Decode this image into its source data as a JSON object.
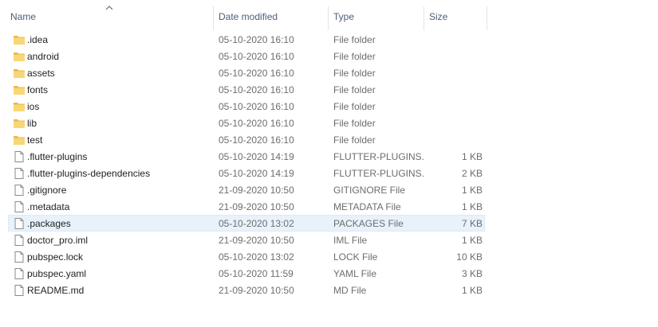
{
  "columns": {
    "name": "Name",
    "date_modified": "Date modified",
    "type": "Type",
    "size": "Size"
  },
  "sort_indicator": "ascending-arrow-icon",
  "colors": {
    "folder": "#f8d775",
    "folder_dark": "#e7b94f",
    "selection_bg": "#e8f2fb",
    "selection_border": "#d9ebf9",
    "header_text": "#4c607a"
  },
  "files": [
    {
      "name": ".idea",
      "date": "05-10-2020 16:10",
      "type": "File folder",
      "size": "",
      "icon": "folder-icon"
    },
    {
      "name": "android",
      "date": "05-10-2020 16:10",
      "type": "File folder",
      "size": "",
      "icon": "folder-icon"
    },
    {
      "name": "assets",
      "date": "05-10-2020 16:10",
      "type": "File folder",
      "size": "",
      "icon": "folder-icon"
    },
    {
      "name": "fonts",
      "date": "05-10-2020 16:10",
      "type": "File folder",
      "size": "",
      "icon": "folder-icon"
    },
    {
      "name": "ios",
      "date": "05-10-2020 16:10",
      "type": "File folder",
      "size": "",
      "icon": "folder-icon"
    },
    {
      "name": "lib",
      "date": "05-10-2020 16:10",
      "type": "File folder",
      "size": "",
      "icon": "folder-icon"
    },
    {
      "name": "test",
      "date": "05-10-2020 16:10",
      "type": "File folder",
      "size": "",
      "icon": "folder-icon"
    },
    {
      "name": ".flutter-plugins",
      "date": "05-10-2020 14:19",
      "type": "FLUTTER-PLUGINS...",
      "size": "1 KB",
      "icon": "file-icon"
    },
    {
      "name": ".flutter-plugins-dependencies",
      "date": "05-10-2020 14:19",
      "type": "FLUTTER-PLUGINS...",
      "size": "2 KB",
      "icon": "file-icon"
    },
    {
      "name": ".gitignore",
      "date": "21-09-2020 10:50",
      "type": "GITIGNORE File",
      "size": "1 KB",
      "icon": "file-icon"
    },
    {
      "name": ".metadata",
      "date": "21-09-2020 10:50",
      "type": "METADATA File",
      "size": "1 KB",
      "icon": "file-icon"
    },
    {
      "name": ".packages",
      "date": "05-10-2020 13:02",
      "type": "PACKAGES File",
      "size": "7 KB",
      "icon": "file-icon",
      "selected": true
    },
    {
      "name": "doctor_pro.iml",
      "date": "21-09-2020 10:50",
      "type": "IML File",
      "size": "1 KB",
      "icon": "file-icon"
    },
    {
      "name": "pubspec.lock",
      "date": "05-10-2020 13:02",
      "type": "LOCK File",
      "size": "10 KB",
      "icon": "file-icon"
    },
    {
      "name": "pubspec.yaml",
      "date": "05-10-2020 11:59",
      "type": "YAML File",
      "size": "3 KB",
      "icon": "file-icon"
    },
    {
      "name": "README.md",
      "date": "21-09-2020 10:50",
      "type": "MD File",
      "size": "1 KB",
      "icon": "file-icon"
    }
  ]
}
